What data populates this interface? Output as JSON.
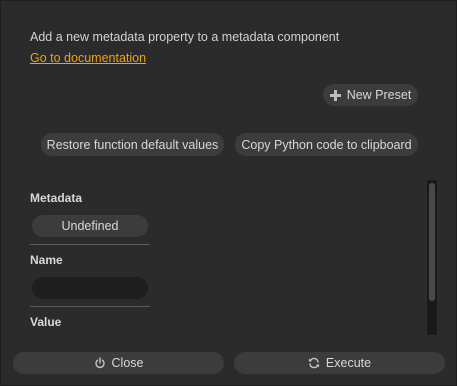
{
  "dialog": {
    "description": "Add a new metadata property to a metadata component",
    "doc_link": "Go to documentation"
  },
  "toolbar": {
    "new_preset_label": "New Preset",
    "new_preset_icon": "plus-icon",
    "restore_label": "Restore function default values",
    "copy_python_label": "Copy Python code to clipboard"
  },
  "fields": {
    "metadata": {
      "label": "Metadata",
      "value": "Undefined"
    },
    "name": {
      "label": "Name",
      "value": ""
    },
    "value": {
      "label": "Value"
    }
  },
  "footer": {
    "close_label": "Close",
    "close_icon": "power-icon",
    "execute_label": "Execute",
    "execute_icon": "refresh-icon"
  },
  "colors": {
    "background": "#2b2b2b",
    "button": "#3c3c3c",
    "input": "#1e1e1e",
    "link": "#f2a20c",
    "text": "#d8d8d8"
  }
}
